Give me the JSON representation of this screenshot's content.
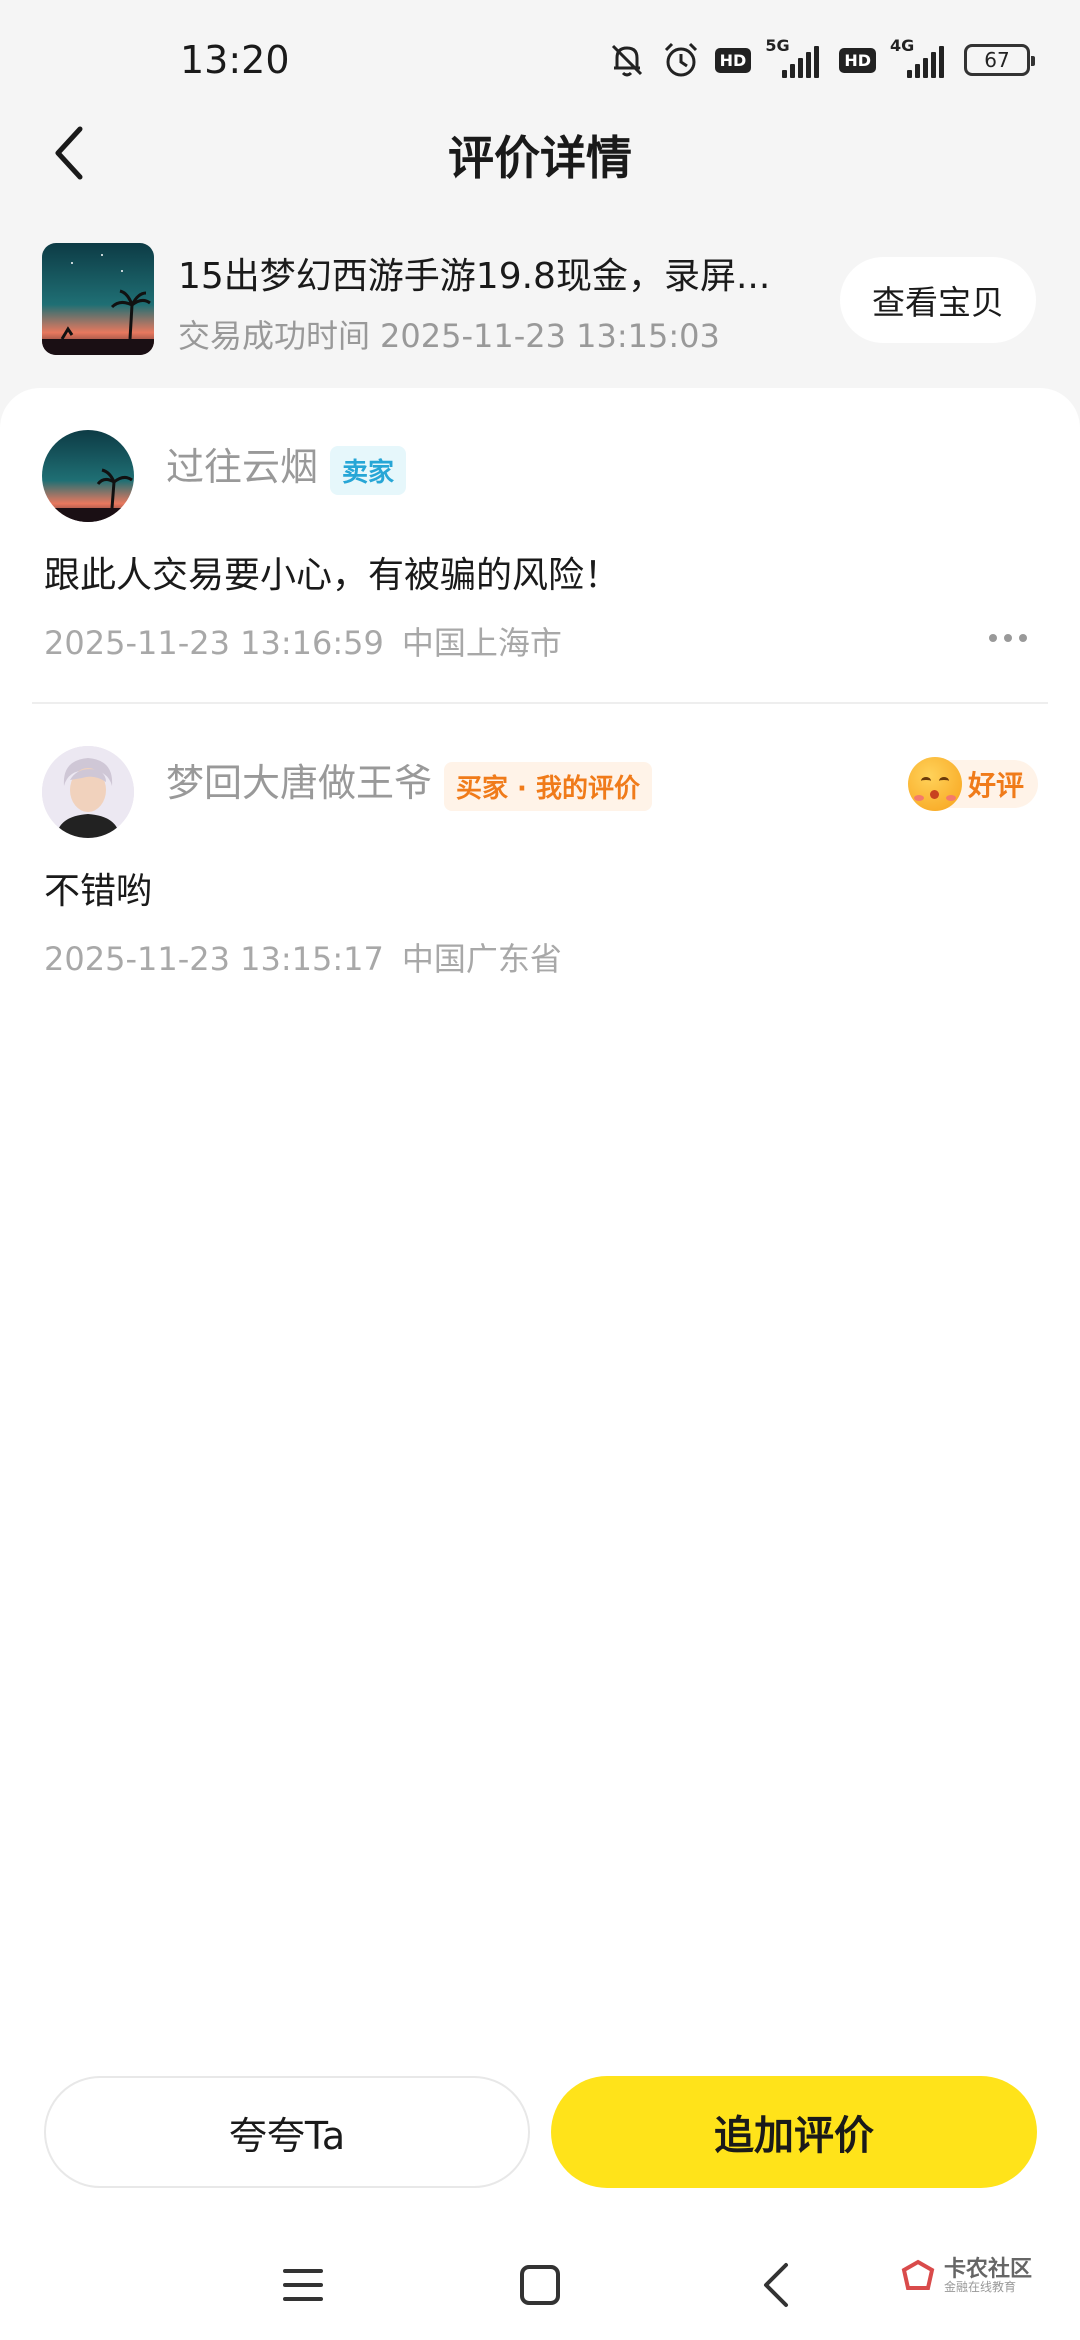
{
  "status_bar": {
    "time": "13:20",
    "network_1": "5G",
    "network_2": "4G",
    "hd_label": "HD",
    "battery": "67",
    "icons": [
      "mute-bell-icon",
      "alarm-icon"
    ]
  },
  "header": {
    "title": "评价详情",
    "back_icon": "chevron-left-icon"
  },
  "item": {
    "title": "15出梦幻西游手游19.8现金，录屏...",
    "time_label": "交易成功时间",
    "time_value": "2025-11-23 13:15:03",
    "view_button": "查看宝贝"
  },
  "reviews": [
    {
      "user_name": "过往云烟",
      "role": "卖家",
      "text": "跟此人交易要小心，有被骗的风险！",
      "datetime": "2025-11-23 13:16:59",
      "location": "中国上海市"
    },
    {
      "user_name": "梦回大唐做王爷",
      "role": "买家 · 我的评价",
      "text": "不错哟",
      "datetime": "2025-11-23 13:15:17",
      "location": "中国广东省",
      "rating": "好评"
    }
  ],
  "actions": {
    "praise": "夸夸Ta",
    "add_review": "追加评价"
  },
  "colors": {
    "accent_yellow": "#ffe31a",
    "seller_badge": "#27a6d6",
    "buyer_badge": "#f07b1a"
  },
  "watermark": {
    "main": "卡农社区",
    "sub": "金融在线教育"
  }
}
